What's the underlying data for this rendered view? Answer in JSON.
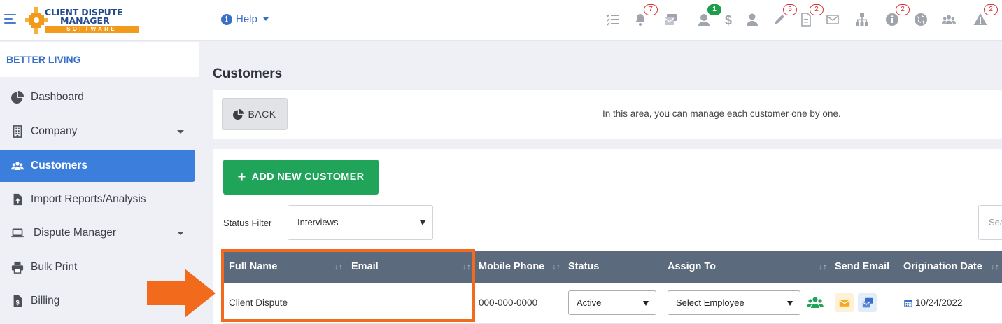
{
  "header": {
    "logo": {
      "line1": "CLIENT DISPUTE",
      "line2": "MANAGER",
      "line3": "SOFTWARE"
    },
    "help_label": "Help",
    "badges": {
      "notifications": "7",
      "clients_online": "1",
      "edit": "5",
      "documents": "2",
      "info": "2",
      "alerts": "2"
    }
  },
  "sidebar": {
    "org_name": "BETTER LIVING",
    "items": [
      {
        "label": "Dashboard"
      },
      {
        "label": "Company"
      },
      {
        "label": "Customers"
      },
      {
        "label": "Import Reports/Analysis"
      },
      {
        "label": "Dispute Manager"
      },
      {
        "label": "Bulk Print"
      },
      {
        "label": "Billing"
      }
    ]
  },
  "main": {
    "title": "Customers",
    "back_label": "BACK",
    "info_text": "In this area, you can manage each customer one by one.",
    "add_button_label": "ADD NEW CUSTOMER",
    "status_filter_label": "Status Filter",
    "status_filter_value": "Interviews",
    "search_placeholder": "Sea"
  },
  "table": {
    "columns": [
      "Full Name",
      "Email",
      "Mobile Phone",
      "Status",
      "Assign To",
      "Send Email",
      "Origination Date"
    ],
    "rows": [
      {
        "full_name": "Client Dispute",
        "email": "",
        "mobile_phone": "000-000-0000",
        "status": "Active",
        "assign_to": "Select Employee",
        "origination_date": "10/24/2022"
      }
    ]
  },
  "colors": {
    "accent": "#3b7edc",
    "success": "#20a45a",
    "table_header": "#5b6a7d",
    "annotation": "#f26a1b"
  }
}
